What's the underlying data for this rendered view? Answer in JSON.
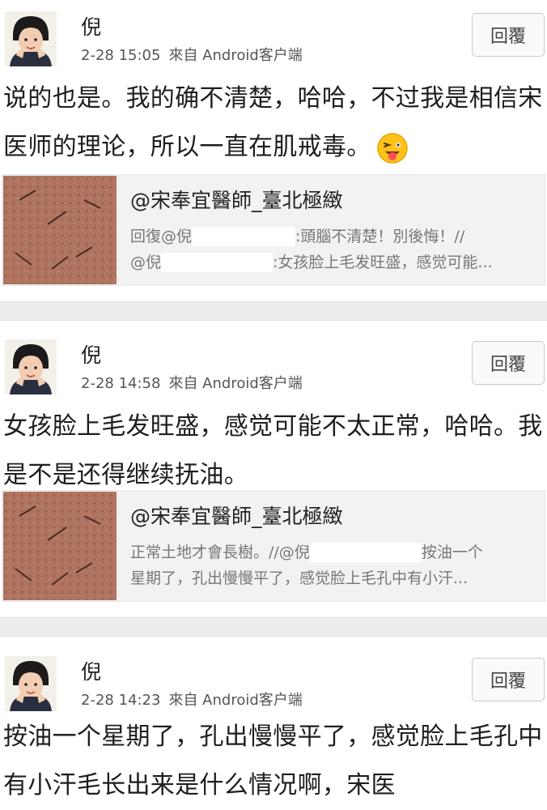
{
  "posts": [
    {
      "name": "倪",
      "time": "2-28 15:05",
      "source": "來自 Android客户端",
      "reply_label": "回覆",
      "text": "说的也是。我的确不清楚，哈哈，不过我是相信宋医师的理论，所以一直在肌戒毒。",
      "emoji_icon": "tongue-out-emoji",
      "quote": {
        "author": "@宋奉宜醫師_臺北極緻",
        "line1_a": "回復@倪",
        "line1_b": ":頭腦不清楚！別後悔！//",
        "line2_a": "@倪",
        "line2_b": ":女孩脸上毛发旺盛，感觉可能..."
      }
    },
    {
      "name": "倪",
      "time": "2-28 14:58",
      "source": "來自 Android客户端",
      "reply_label": "回覆",
      "text": "女孩脸上毛发旺盛，感觉可能不太正常，哈哈。我是不是还得继续抚油。",
      "quote": {
        "author": "@宋奉宜醫師_臺北極緻",
        "line1_a": "正常土地才會長樹。//@倪",
        "line1_b": "按油一个",
        "line2_a": "星期了，孔出慢慢平了，感觉脸上毛孔中有小汗...",
        "line2_b": ""
      }
    },
    {
      "name": "倪",
      "time": "2-28 14:23",
      "source": "來自 Android客户端",
      "reply_label": "回覆",
      "text": "按油一个星期了，孔出慢慢平了，感觉脸上毛孔中有小汗毛长出来是什么情况啊，宋医"
    }
  ],
  "colors": {
    "background": "#ffffff",
    "separator": "#ededed",
    "quote_bg": "#f2f2f2",
    "muted_text": "#777777"
  }
}
